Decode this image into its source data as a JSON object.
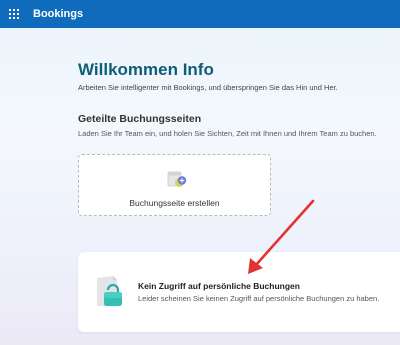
{
  "header": {
    "app_title": "Bookings",
    "waffle_icon": "app-launcher-icon",
    "bar_color": "#0f6cbd"
  },
  "welcome": {
    "title": "Willkommen Info",
    "subtitle": "Arbeiten Sie intelligenter mit Bookings, und überspringen Sie das Hin und Her."
  },
  "shared_pages": {
    "title": "Geteilte Buchungsseiten",
    "subtitle": "Laden Sie Ihr Team ein, und holen Sie Sichten, Zeit mit Ihnen und Ihrem Team zu buchen.",
    "create_card": {
      "label": "Buchungsseite erstellen",
      "icon": "calendar-add-icon"
    }
  },
  "no_access": {
    "title": "Kein Zugriff auf persönliche Buchungen",
    "message": "Leider scheinen Sie keinen Zugriff auf persönliche Buchungen zu haben.",
    "icon": "lock-icon"
  },
  "annotation": {
    "arrow_color": "#e03434"
  }
}
